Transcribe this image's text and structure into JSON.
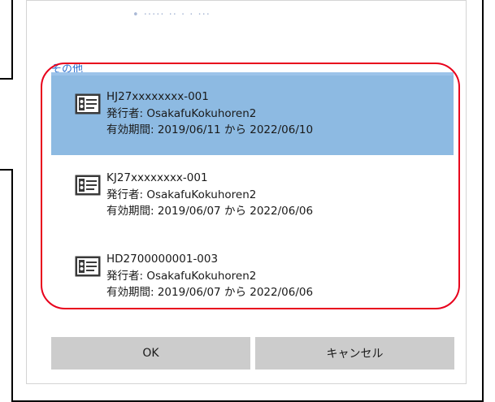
{
  "dialog": {
    "top_faded_text": "• ····· ·· · · ···",
    "section_label": "その他",
    "certificates": [
      {
        "name": "HJ27xxxxxxxx-001",
        "issuer_line": "発行者: OsakafuKokuhoren2",
        "validity_line": "有効期間: 2019/06/11 から 2022/06/10",
        "selected": true
      },
      {
        "name": "KJ27xxxxxxxx-001",
        "issuer_line": "発行者: OsakafuKokuhoren2",
        "validity_line": "有効期間: 2019/06/07 から 2022/06/06",
        "selected": false
      },
      {
        "name": "HD2700000001-003",
        "issuer_line": "発行者: OsakafuKokuhoren2",
        "validity_line": "有効期間: 2019/06/07 から 2022/06/06",
        "selected": false
      }
    ],
    "buttons": {
      "ok_label": "OK",
      "cancel_label": "キャンセル"
    }
  },
  "colors": {
    "selected_bg": "#8dbae2",
    "accent_text": "#2b6fcf",
    "highlight_ring": "#e8001c",
    "button_bg": "#cccccc"
  },
  "icons": {
    "certificate": "certificate-card-icon"
  }
}
